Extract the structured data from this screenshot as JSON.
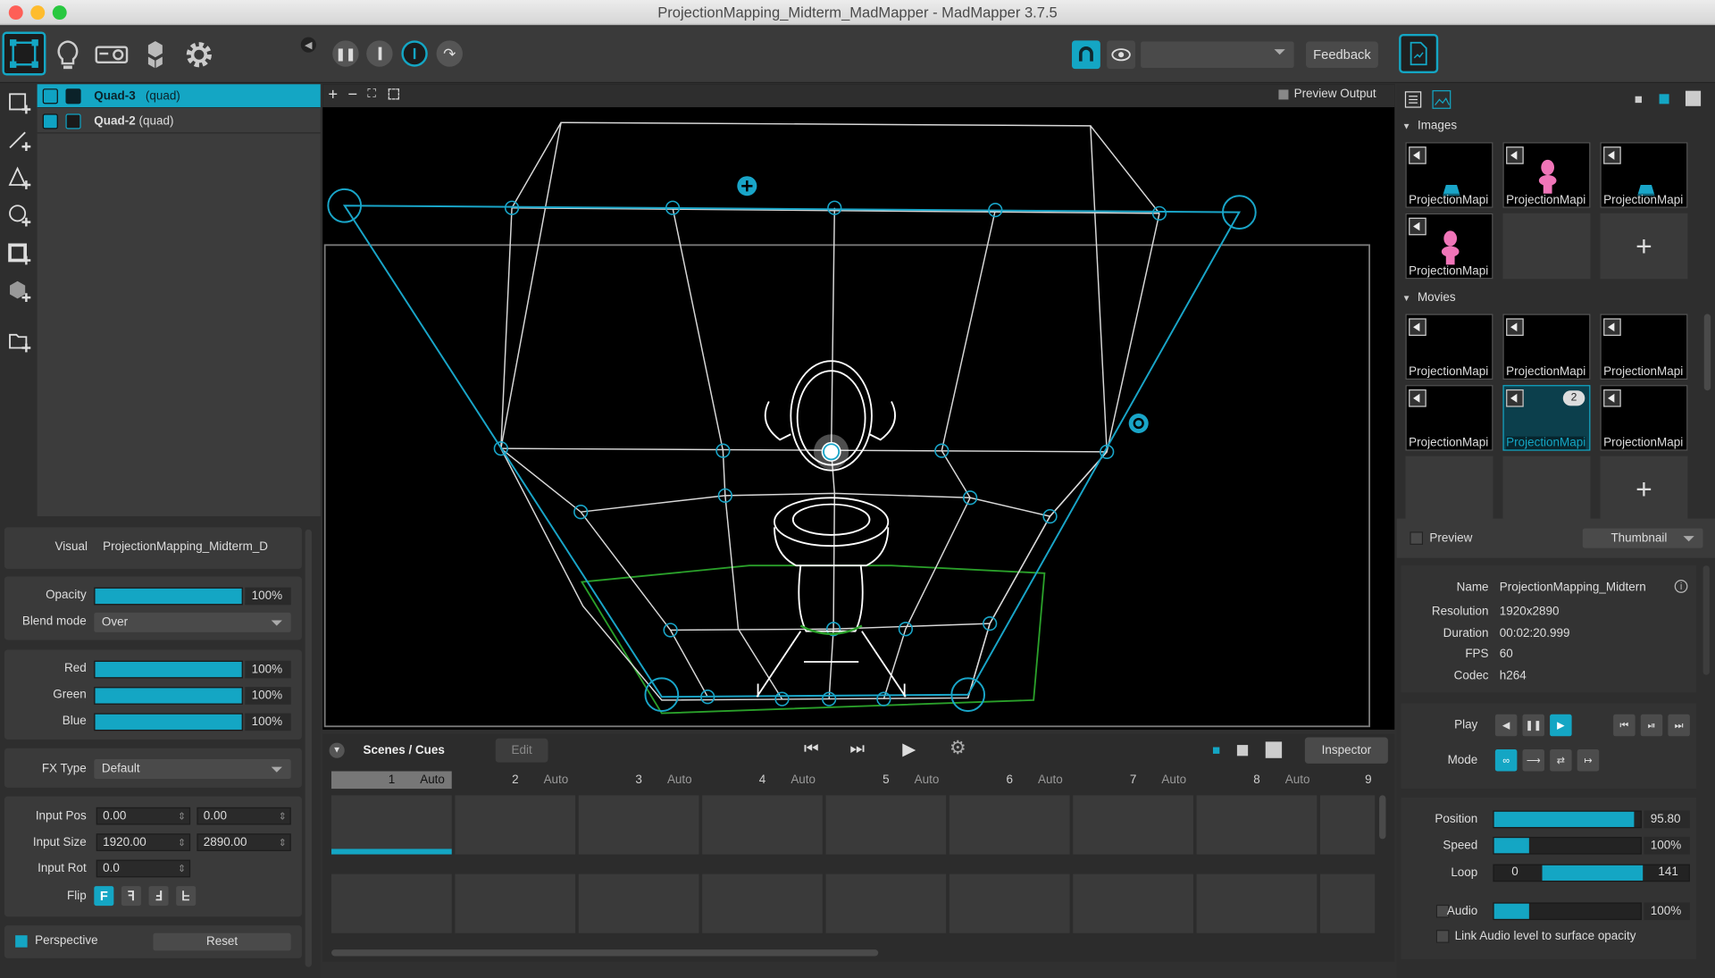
{
  "window": {
    "title": "ProjectionMapping_Midterm_MadMapper - MadMapper 3.7.5"
  },
  "toolbar": {
    "feedback_label": "Feedback",
    "output_select_value": ""
  },
  "layers": [
    {
      "name": "Quad-3",
      "type": "(quad)",
      "selected": true
    },
    {
      "name": "Quad-2",
      "type": "(quad)",
      "selected": false
    }
  ],
  "inspector": {
    "visual_label": "Visual",
    "visual_value": "ProjectionMapping_Midterm_D",
    "opacity_label": "Opacity",
    "opacity_value": "100%",
    "opacity_level": 1.0,
    "blend_label": "Blend mode",
    "blend_value": "Over",
    "red_label": "Red",
    "red_value": "100%",
    "green_label": "Green",
    "green_value": "100%",
    "blue_label": "Blue",
    "blue_value": "100%",
    "fx_label": "FX Type",
    "fx_value": "Default",
    "input_pos_label": "Input Pos",
    "input_pos_x": "0.00",
    "input_pos_y": "0.00",
    "input_size_label": "Input Size",
    "input_size_w": "1920.00",
    "input_size_h": "2890.00",
    "input_rot_label": "Input Rot",
    "input_rot_value": "0.0",
    "flip_label": "Flip",
    "perspective_label": "Perspective",
    "reset_label": "Reset"
  },
  "viewer": {
    "preview_output_label": "Preview Output"
  },
  "scenes": {
    "title": "Scenes / Cues",
    "edit_label": "Edit",
    "inspector_label": "Inspector",
    "cues": [
      {
        "num": "1",
        "mode": "Auto"
      },
      {
        "num": "2",
        "mode": "Auto"
      },
      {
        "num": "3",
        "mode": "Auto"
      },
      {
        "num": "4",
        "mode": "Auto"
      },
      {
        "num": "5",
        "mode": "Auto"
      },
      {
        "num": "6",
        "mode": "Auto"
      },
      {
        "num": "7",
        "mode": "Auto"
      },
      {
        "num": "8",
        "mode": "Auto"
      },
      {
        "num": "9",
        "mode": ""
      }
    ]
  },
  "media": {
    "images_label": "Images",
    "movies_label": "Movies",
    "thumb_label": "ProjectionMapi",
    "selected_movie_badge": "2",
    "preview_label": "Preview",
    "preview_mode": "Thumbnail"
  },
  "info": {
    "name_label": "Name",
    "name_value": "ProjectionMapping_Midtern",
    "resolution_label": "Resolution",
    "resolution_value": "1920x2890",
    "duration_label": "Duration",
    "duration_value": "00:02:20.999",
    "fps_label": "FPS",
    "fps_value": "60",
    "codec_label": "Codec",
    "codec_value": "h264"
  },
  "playback": {
    "play_label": "Play",
    "mode_label": "Mode",
    "position_label": "Position",
    "position_value": "95.80",
    "position_level": 0.958,
    "speed_label": "Speed",
    "speed_value": "100%",
    "speed_level": 0.24,
    "loop_label": "Loop",
    "loop_start": "0",
    "loop_end": "141",
    "audio_label": "Audio",
    "audio_value": "100%",
    "audio_level": 0.24,
    "link_audio_label": "Link Audio level to surface opacity"
  },
  "colors": {
    "accent": "#14a6c4",
    "selection": "#0fa3c3",
    "mesh_green": "#2aa02a"
  }
}
